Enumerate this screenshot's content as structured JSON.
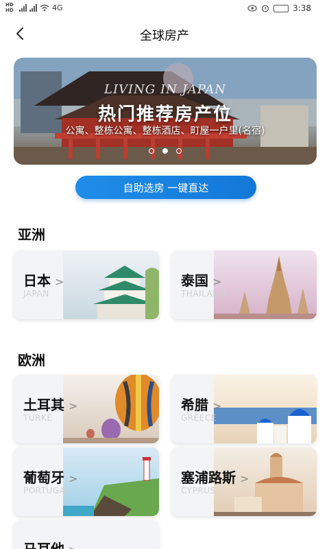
{
  "status_bar": {
    "network_left": "HD HD",
    "speed": "4G",
    "time": "3:38"
  },
  "header": {
    "title": "全球房产"
  },
  "banner": {
    "eyebrow": "LIVING IN JAPAN",
    "title": "热门推荐房产位",
    "subtitle": "公寓、整栋公寓、整栋酒店、町屋一户里(名宿)",
    "active_slide": 2,
    "slide_count": 3
  },
  "cta": {
    "label": "自助选房 一键直达"
  },
  "sections": {
    "asia": {
      "title": "亚洲",
      "cards": [
        {
          "name": "日本",
          "en": "JAPAN"
        },
        {
          "name": "泰国",
          "en": "THAILAND"
        }
      ]
    },
    "europe": {
      "title": "欧洲",
      "cards": [
        {
          "name": "土耳其",
          "en": "TURKE"
        },
        {
          "name": "希腊",
          "en": "GREECE"
        },
        {
          "name": "葡萄牙",
          "en": "PORTUGAL"
        },
        {
          "name": "塞浦路斯",
          "en": "CYPRUS"
        },
        {
          "name": "马耳他",
          "en": ""
        }
      ]
    }
  },
  "arrow_glyph": ">",
  "colors": {
    "accent": "#1f8de8",
    "heading_highlight": "#cfe3f5"
  }
}
